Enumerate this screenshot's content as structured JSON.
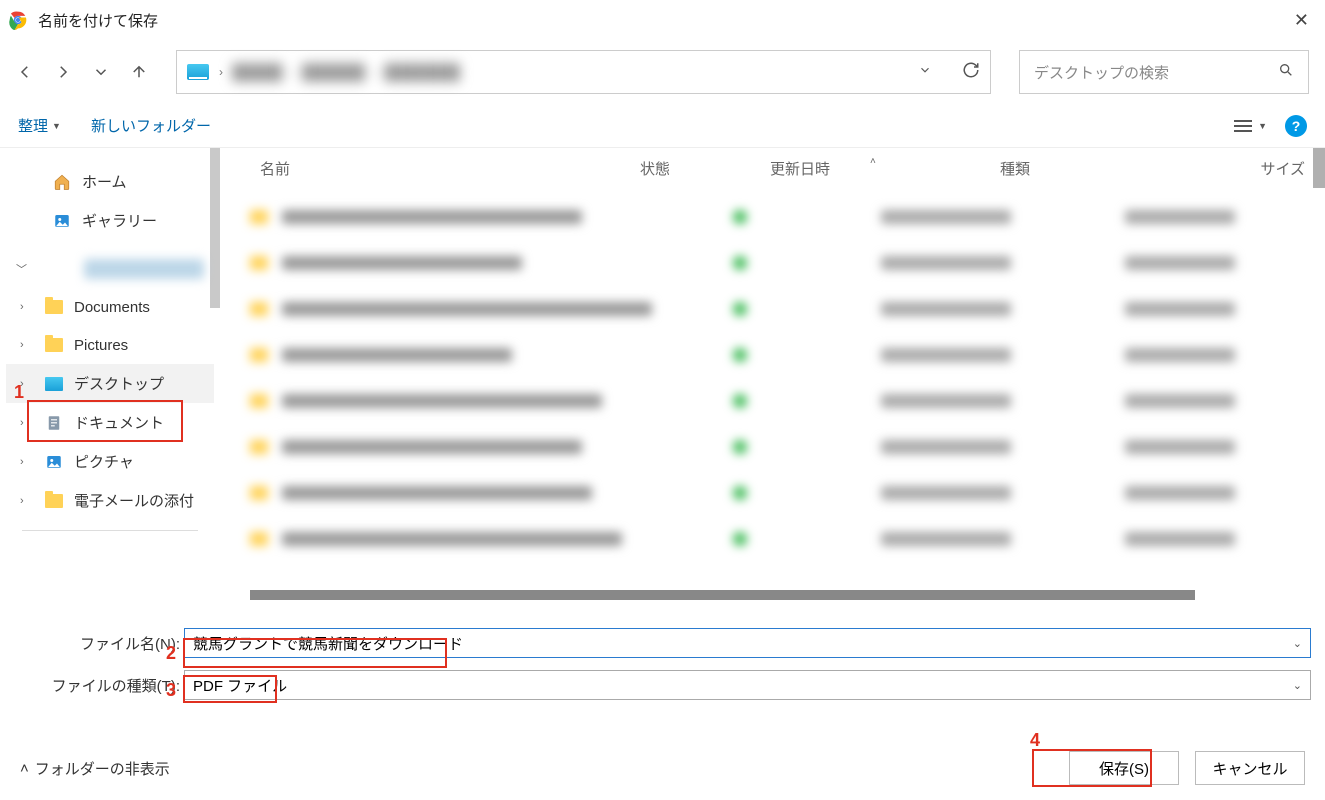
{
  "title": "名前を付けて保存",
  "search_placeholder": "デスクトップの検索",
  "toolbar": {
    "organize": "整理",
    "new_folder": "新しいフォルダー"
  },
  "sidebar": {
    "home": "ホーム",
    "gallery": "ギャラリー",
    "documents": "Documents",
    "pictures": "Pictures",
    "desktop": "デスクトップ",
    "jp_documents": "ドキュメント",
    "jp_pictures": "ピクチャ",
    "email_attach": "電子メールの添付"
  },
  "columns": {
    "name": "名前",
    "state": "状態",
    "modified": "更新日時",
    "type": "種類",
    "size": "サイズ"
  },
  "form": {
    "filename_label": "ファイル名(N):",
    "filename_value": "競馬グラントで競馬新聞をダウンロード",
    "filetype_label": "ファイルの種類(T):",
    "filetype_value": "PDF ファイル"
  },
  "footer": {
    "hide_folders": "フォルダーの非表示",
    "save": "保存(S)",
    "cancel": "キャンセル"
  },
  "annotations": {
    "a1": "1",
    "a2": "2",
    "a3": "3",
    "a4": "4"
  }
}
